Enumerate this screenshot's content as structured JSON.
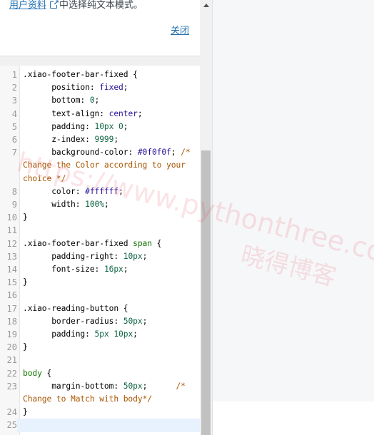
{
  "notice": {
    "link_text": "用户资料",
    "text_after": "中选择纯文本模式。",
    "close_label": "关闭"
  },
  "editor": {
    "active_line": 25,
    "lines": [
      {
        "n": "1",
        "parts": [
          {
            "t": ".xiao-footer-bar-fixed {",
            "c": "prop"
          }
        ]
      },
      {
        "n": "2",
        "parts": [
          {
            "t": "      position: ",
            "c": "prop"
          },
          {
            "t": "fixed",
            "c": "kw"
          },
          {
            "t": ";",
            "c": "prop"
          }
        ]
      },
      {
        "n": "3",
        "parts": [
          {
            "t": "      bottom: ",
            "c": "prop"
          },
          {
            "t": "0",
            "c": "num"
          },
          {
            "t": ";",
            "c": "prop"
          }
        ]
      },
      {
        "n": "4",
        "parts": [
          {
            "t": "      text-align: ",
            "c": "prop"
          },
          {
            "t": "center",
            "c": "kw"
          },
          {
            "t": ";",
            "c": "prop"
          }
        ]
      },
      {
        "n": "5",
        "parts": [
          {
            "t": "      padding: ",
            "c": "prop"
          },
          {
            "t": "10px 0",
            "c": "num"
          },
          {
            "t": ";",
            "c": "prop"
          }
        ]
      },
      {
        "n": "6",
        "parts": [
          {
            "t": "      z-index: ",
            "c": "prop"
          },
          {
            "t": "9999",
            "c": "num"
          },
          {
            "t": ";",
            "c": "prop"
          }
        ]
      },
      {
        "n": "7",
        "parts": [
          {
            "t": "      background-color: ",
            "c": "prop"
          },
          {
            "t": "#0f0f0f",
            "c": "kw"
          },
          {
            "t": "; ",
            "c": "prop"
          },
          {
            "t": "/* Change the Color according to your choice */",
            "c": "cm"
          }
        ]
      },
      {
        "n": "8",
        "parts": [
          {
            "t": "      color: ",
            "c": "prop"
          },
          {
            "t": "#ffffff",
            "c": "kw"
          },
          {
            "t": ";",
            "c": "prop"
          }
        ]
      },
      {
        "n": "9",
        "parts": [
          {
            "t": "      width: ",
            "c": "prop"
          },
          {
            "t": "100%",
            "c": "num"
          },
          {
            "t": ";",
            "c": "prop"
          }
        ]
      },
      {
        "n": "10",
        "parts": [
          {
            "t": "}",
            "c": "prop"
          }
        ]
      },
      {
        "n": "11",
        "parts": [
          {
            "t": "",
            "c": "prop"
          }
        ]
      },
      {
        "n": "12",
        "parts": [
          {
            "t": ".xiao-footer-bar-fixed ",
            "c": "prop"
          },
          {
            "t": "span",
            "c": "tag"
          },
          {
            "t": " {",
            "c": "prop"
          }
        ]
      },
      {
        "n": "13",
        "parts": [
          {
            "t": "      padding-right: ",
            "c": "prop"
          },
          {
            "t": "10px",
            "c": "num"
          },
          {
            "t": ";",
            "c": "prop"
          }
        ]
      },
      {
        "n": "14",
        "parts": [
          {
            "t": "      font-size: ",
            "c": "prop"
          },
          {
            "t": "16px",
            "c": "num"
          },
          {
            "t": ";",
            "c": "prop"
          }
        ]
      },
      {
        "n": "15",
        "parts": [
          {
            "t": "}",
            "c": "prop"
          }
        ]
      },
      {
        "n": "16",
        "parts": [
          {
            "t": "",
            "c": "prop"
          }
        ]
      },
      {
        "n": "17",
        "parts": [
          {
            "t": ".xiao-reading-button {",
            "c": "prop"
          }
        ]
      },
      {
        "n": "18",
        "parts": [
          {
            "t": "      border-radius: ",
            "c": "prop"
          },
          {
            "t": "50px",
            "c": "num"
          },
          {
            "t": ";",
            "c": "prop"
          }
        ]
      },
      {
        "n": "19",
        "parts": [
          {
            "t": "      padding: ",
            "c": "prop"
          },
          {
            "t": "5px 10px",
            "c": "num"
          },
          {
            "t": ";",
            "c": "prop"
          }
        ]
      },
      {
        "n": "20",
        "parts": [
          {
            "t": "}",
            "c": "prop"
          }
        ]
      },
      {
        "n": "21",
        "parts": [
          {
            "t": "",
            "c": "prop"
          }
        ]
      },
      {
        "n": "22",
        "parts": [
          {
            "t": "body",
            "c": "tag"
          },
          {
            "t": " {",
            "c": "prop"
          }
        ]
      },
      {
        "n": "23",
        "parts": [
          {
            "t": "      margin-bottom: ",
            "c": "prop"
          },
          {
            "t": "50px",
            "c": "num"
          },
          {
            "t": ";      ",
            "c": "prop"
          },
          {
            "t": "/* Change to Match with body*/",
            "c": "cm"
          }
        ]
      },
      {
        "n": "24",
        "parts": [
          {
            "t": "}",
            "c": "prop"
          }
        ]
      },
      {
        "n": "25",
        "parts": [
          {
            "t": "",
            "c": "prop"
          }
        ]
      }
    ]
  },
  "watermark": {
    "url": "https://www.pythonthree.com",
    "name": "晓得博客"
  }
}
